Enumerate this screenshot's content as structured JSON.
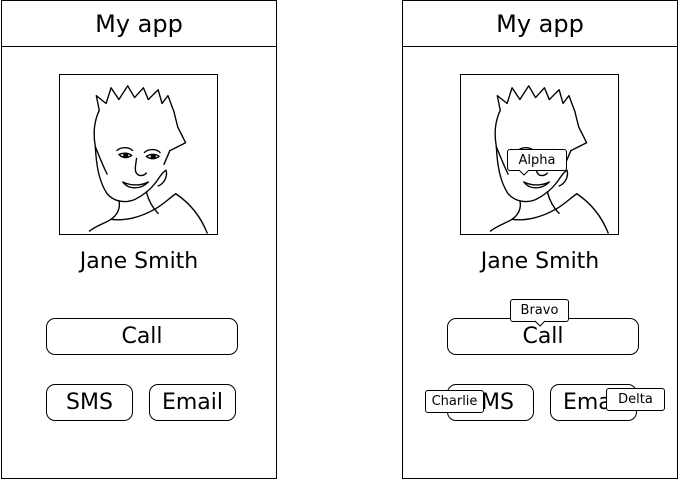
{
  "screens": [
    {
      "app_title": "My app",
      "contact_name": "Jane Smith",
      "call_label": "Call",
      "sms_label": "SMS",
      "email_label": "Email"
    },
    {
      "app_title": "My app",
      "contact_name": "Jane Smith",
      "call_label": "Call",
      "sms_label": "SMS",
      "email_label": "Email",
      "hints": {
        "photo": "Alpha",
        "call": "Bravo",
        "sms": "Charlie",
        "email": "Delta"
      }
    }
  ]
}
